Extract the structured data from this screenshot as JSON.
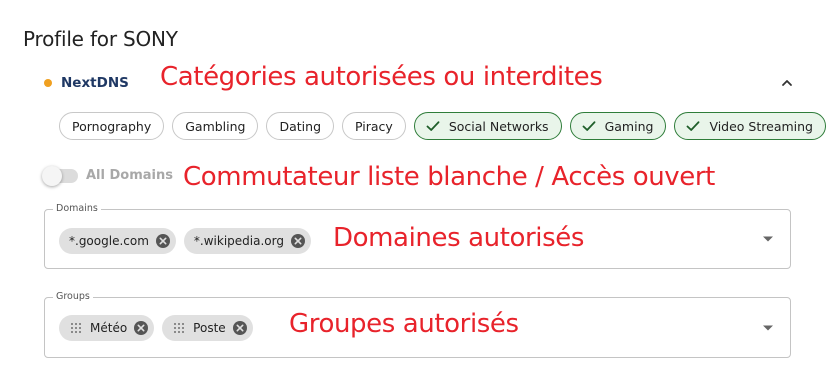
{
  "profile": {
    "title": "Profile for SONY"
  },
  "nextdns": {
    "label": "NextDNS",
    "status_color": "#f0a020"
  },
  "annotations": {
    "categories": "Catégories autorisées ou interdites",
    "switch": "Commutateur liste blanche / Accès ouvert",
    "domains": "Domaines autorisés",
    "groups": "Groupes autorisés",
    "color": "#e8232b"
  },
  "categories": [
    {
      "label": "Pornography",
      "selected": false
    },
    {
      "label": "Gambling",
      "selected": false
    },
    {
      "label": "Dating",
      "selected": false
    },
    {
      "label": "Piracy",
      "selected": false
    },
    {
      "label": "Social Networks",
      "selected": true
    },
    {
      "label": "Gaming",
      "selected": true
    },
    {
      "label": "Video Streaming",
      "selected": true
    }
  ],
  "switch": {
    "label": "All Domains",
    "on": false
  },
  "domains": {
    "legend": "Domains",
    "items": [
      "*.google.com",
      "*.wikipedia.org"
    ]
  },
  "groups": {
    "legend": "Groups",
    "items": [
      "Météo",
      "Poste"
    ]
  },
  "icons": {
    "check": "check-icon",
    "remove": "cancel-circle-icon",
    "group": "grid-icon",
    "collapse": "chevron-up-icon",
    "dropdown": "arrow-drop-down-icon"
  }
}
